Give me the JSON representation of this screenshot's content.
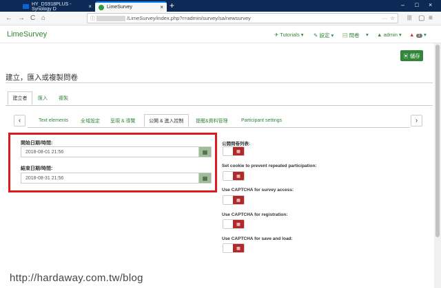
{
  "browser": {
    "tabs": [
      {
        "title": "HY_DS918PLUS - Synology D",
        "favicon_color": "#0a64d8"
      },
      {
        "title": "LimeSurvey",
        "favicon_color": "#2e9e3a"
      }
    ],
    "new_tab": "+",
    "close_glyph": "×",
    "window_controls": [
      "–",
      "□",
      "×"
    ],
    "url_suffix": "/LimeSurvey/index.php?r=admin/survey/sa/newsurvey",
    "url_menu": "···",
    "nav_icons": [
      "←",
      "→",
      "C",
      "⌂"
    ]
  },
  "header": {
    "brand": "LimeSurvey",
    "menu": {
      "tutorials": "✈ Tutorials ▾",
      "settings": "✎ 設定 ▾",
      "surveys": "▤ 問卷",
      "caret": "▾",
      "user": "▲ admin ▾",
      "notif_icon": "▲",
      "notif_count": "1",
      "notif_caret": "▾"
    }
  },
  "toolbar": {
    "save_label": "▣ 儲存"
  },
  "page": {
    "title": "建立，匯入或複製問卷"
  },
  "level1_tabs": [
    "建立者",
    "匯入",
    "複製"
  ],
  "section_tabs": [
    "Text elements",
    "全域設定",
    "呈現 & 導覽",
    "公開 & 進入控制",
    "提醒&資料管理",
    "Participant settings"
  ],
  "scroll_left": "‹",
  "scroll_right": "›",
  "form": {
    "start_label": "開始日期/時間:",
    "start_value": "2018-08-01 21:56",
    "end_label": "結束日期/時間:",
    "end_value": "2018-08-31 21:56",
    "calendar_glyph": "▦"
  },
  "options": [
    "公開問卷列表:",
    "Set cookie to prevent repeated participation:",
    "Use CAPTCHA for survey access:",
    "Use CAPTCHA for registration:",
    "Use CAPTCHA for save and load:"
  ],
  "toggle_glyph": "▦",
  "watermark": "http://hardaway.com.tw/blog"
}
